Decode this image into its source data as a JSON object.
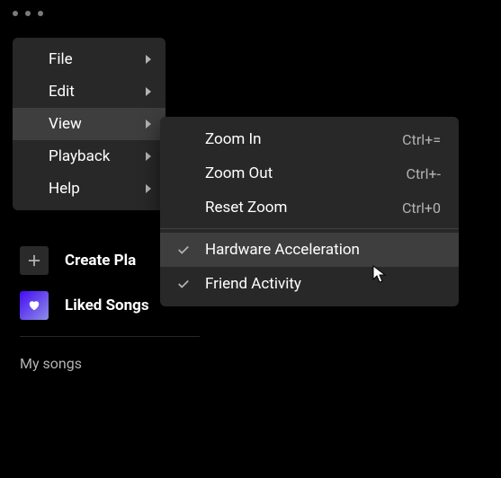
{
  "menuBar": {
    "items": [
      {
        "label": "File"
      },
      {
        "label": "Edit"
      },
      {
        "label": "View"
      },
      {
        "label": "Playback"
      },
      {
        "label": "Help"
      }
    ]
  },
  "viewSubmenu": {
    "zoomIn": {
      "label": "Zoom In",
      "shortcut": "Ctrl+="
    },
    "zoomOut": {
      "label": "Zoom Out",
      "shortcut": "Ctrl+-"
    },
    "resetZoom": {
      "label": "Reset Zoom",
      "shortcut": "Ctrl+0"
    },
    "hardwareAccel": {
      "label": "Hardware Acceleration"
    },
    "friendActivity": {
      "label": "Friend Activity"
    }
  },
  "sidebar": {
    "createPlaylist": "Create Pla",
    "likedSongs": "Liked Songs",
    "mySongs": "My songs"
  }
}
